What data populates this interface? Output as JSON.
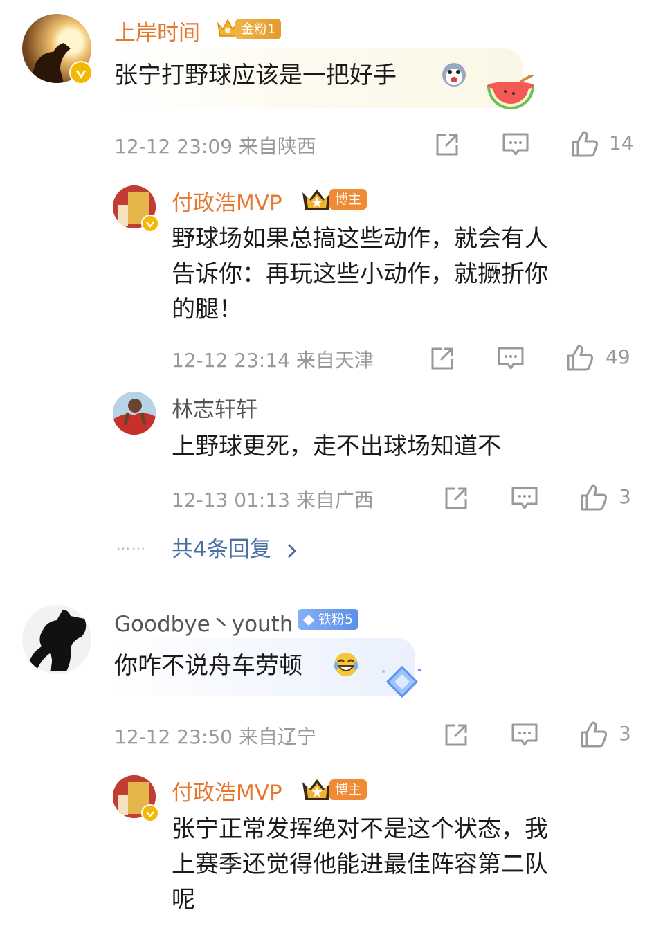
{
  "comments": [
    {
      "username": "上岸时间",
      "badge": "金粉1",
      "text": "张宁打野球应该是一把好手",
      "time": "12-12 23:09",
      "location": "来自陕西",
      "likes": "14",
      "replies": [
        {
          "username": "付政浩MVP",
          "badge": "博主",
          "text_lines": [
            "野球场如果总搞这些动作，就会有人",
            "告诉你：再玩这些小动作，就撅折你",
            "的腿！"
          ],
          "time": "12-12 23:14",
          "location": "来自天津",
          "likes": "49"
        },
        {
          "username": "林志轩轩",
          "text": "上野球更死，走不出球场知道不",
          "time": "12-13 01:13",
          "location": "来自广西",
          "likes": "3"
        }
      ],
      "more_replies": "共4条回复",
      "more_dots": "……"
    },
    {
      "username": "Goodbye丶youth",
      "badge": "铁粉5",
      "text": "你咋不说舟车劳顿",
      "time": "12-12 23:50",
      "location": "来自辽宁",
      "likes": "3",
      "replies": [
        {
          "username": "付政浩MVP",
          "badge": "博主",
          "text_lines": [
            "张宁正常发挥绝对不是这个状态，我",
            "上赛季还觉得他能进最佳阵容第二队",
            "呢"
          ]
        }
      ]
    }
  ],
  "colors": {
    "orange": "#e8772e",
    "gold_badge": "#e9a437",
    "blue_badge": "#6f9df0",
    "blogger_badge": "#f08a34",
    "link": "#4a6fa5"
  }
}
